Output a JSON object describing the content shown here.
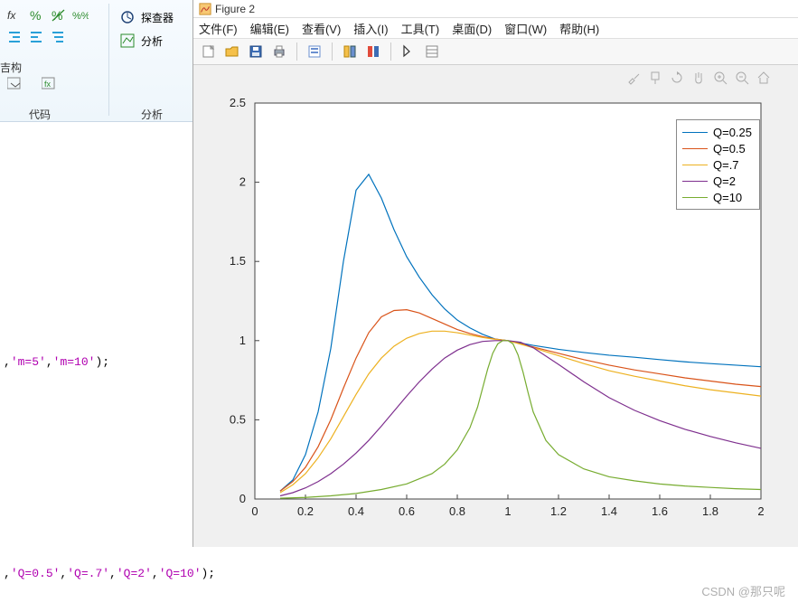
{
  "matlab_ribbon": {
    "group1_label": "代码",
    "group2_label": "分析",
    "btn_explorer": "探查器",
    "btn_analyze": "分析",
    "struct_label": "吉构"
  },
  "code": {
    "line1_prefix": ",",
    "line1_s1": "'m=5'",
    "line1_mid": ",",
    "line1_s2": "'m=10'",
    "line1_suffix": ");",
    "line2_prefix": ",",
    "line2_s1": "'Q=0.5'",
    "line2_m1": ",",
    "line2_s2": "'Q=.7'",
    "line2_m2": ",",
    "line2_s3": "'Q=2'",
    "line2_m3": ",",
    "line2_s4": "'Q=10'",
    "line2_suffix": ");"
  },
  "figwin": {
    "title": "Figure 2",
    "menus": [
      "文件(F)",
      "编辑(E)",
      "查看(V)",
      "插入(I)",
      "工具(T)",
      "桌面(D)",
      "窗口(W)",
      "帮助(H)"
    ]
  },
  "chart_data": {
    "type": "line",
    "xlim": [
      0,
      2
    ],
    "ylim": [
      0,
      2.5
    ],
    "xticks": [
      0,
      0.2,
      0.4,
      0.6,
      0.8,
      1,
      1.2,
      1.4,
      1.6,
      1.8,
      2
    ],
    "yticks": [
      0,
      0.5,
      1,
      1.5,
      2,
      2.5
    ],
    "xlabel": "",
    "ylabel": "",
    "title": "",
    "colors": {
      "Q=0.25": "#0072BD",
      "Q=0.5": "#D95319",
      "Q=.7": "#EDB120",
      "Q=2": "#7E2F8E",
      "Q=10": "#77AC30"
    },
    "legend": [
      "Q=0.25",
      "Q=0.5",
      "Q=.7",
      "Q=2",
      "Q=10"
    ],
    "series": [
      {
        "name": "Q=0.25",
        "x": [
          0.1,
          0.15,
          0.2,
          0.25,
          0.3,
          0.35,
          0.4,
          0.45,
          0.5,
          0.55,
          0.6,
          0.65,
          0.7,
          0.75,
          0.8,
          0.85,
          0.9,
          0.95,
          1.0,
          1.1,
          1.2,
          1.3,
          1.4,
          1.5,
          1.6,
          1.7,
          1.8,
          1.9,
          2.0
        ],
        "y": [
          0.05,
          0.12,
          0.28,
          0.55,
          0.95,
          1.5,
          1.95,
          2.05,
          1.9,
          1.7,
          1.53,
          1.4,
          1.29,
          1.2,
          1.13,
          1.08,
          1.04,
          1.01,
          1.0,
          0.97,
          0.945,
          0.925,
          0.908,
          0.895,
          0.88,
          0.866,
          0.855,
          0.845,
          0.835
        ]
      },
      {
        "name": "Q=0.5",
        "x": [
          0.1,
          0.15,
          0.2,
          0.25,
          0.3,
          0.35,
          0.4,
          0.45,
          0.5,
          0.55,
          0.6,
          0.65,
          0.7,
          0.75,
          0.8,
          0.85,
          0.9,
          0.95,
          1.0,
          1.1,
          1.2,
          1.3,
          1.4,
          1.5,
          1.6,
          1.7,
          1.8,
          1.9,
          2.0
        ],
        "y": [
          0.05,
          0.11,
          0.2,
          0.33,
          0.5,
          0.7,
          0.89,
          1.05,
          1.15,
          1.19,
          1.195,
          1.175,
          1.14,
          1.105,
          1.07,
          1.045,
          1.025,
          1.01,
          1.0,
          0.96,
          0.92,
          0.88,
          0.845,
          0.815,
          0.79,
          0.765,
          0.745,
          0.725,
          0.71
        ]
      },
      {
        "name": "Q=.7",
        "x": [
          0.1,
          0.15,
          0.2,
          0.25,
          0.3,
          0.35,
          0.4,
          0.45,
          0.5,
          0.55,
          0.6,
          0.65,
          0.7,
          0.75,
          0.8,
          0.85,
          0.9,
          0.95,
          1.0,
          1.1,
          1.2,
          1.3,
          1.4,
          1.5,
          1.6,
          1.7,
          1.8,
          1.9,
          2.0
        ],
        "y": [
          0.04,
          0.09,
          0.16,
          0.26,
          0.38,
          0.52,
          0.66,
          0.79,
          0.89,
          0.965,
          1.015,
          1.045,
          1.06,
          1.06,
          1.05,
          1.035,
          1.02,
          1.008,
          1.0,
          0.955,
          0.905,
          0.855,
          0.81,
          0.775,
          0.745,
          0.715,
          0.69,
          0.67,
          0.65
        ]
      },
      {
        "name": "Q=2",
        "x": [
          0.1,
          0.15,
          0.2,
          0.25,
          0.3,
          0.35,
          0.4,
          0.45,
          0.5,
          0.55,
          0.6,
          0.65,
          0.7,
          0.75,
          0.8,
          0.85,
          0.9,
          0.95,
          1.0,
          1.05,
          1.1,
          1.2,
          1.3,
          1.4,
          1.5,
          1.6,
          1.7,
          1.8,
          1.9,
          2.0
        ],
        "y": [
          0.02,
          0.04,
          0.07,
          0.11,
          0.16,
          0.22,
          0.29,
          0.37,
          0.46,
          0.555,
          0.65,
          0.74,
          0.82,
          0.89,
          0.94,
          0.975,
          0.995,
          1.0,
          1.0,
          0.99,
          0.955,
          0.85,
          0.74,
          0.64,
          0.56,
          0.495,
          0.44,
          0.395,
          0.355,
          0.32
        ]
      },
      {
        "name": "Q=10",
        "x": [
          0.1,
          0.2,
          0.3,
          0.4,
          0.5,
          0.6,
          0.7,
          0.75,
          0.8,
          0.85,
          0.88,
          0.9,
          0.92,
          0.94,
          0.96,
          0.98,
          1.0,
          1.02,
          1.04,
          1.06,
          1.08,
          1.1,
          1.15,
          1.2,
          1.3,
          1.4,
          1.5,
          1.6,
          1.7,
          1.8,
          1.9,
          2.0
        ],
        "y": [
          0.005,
          0.01,
          0.02,
          0.035,
          0.06,
          0.095,
          0.16,
          0.22,
          0.31,
          0.45,
          0.58,
          0.7,
          0.82,
          0.92,
          0.98,
          1.0,
          1.0,
          0.98,
          0.91,
          0.8,
          0.67,
          0.55,
          0.37,
          0.28,
          0.19,
          0.14,
          0.115,
          0.095,
          0.082,
          0.073,
          0.065,
          0.06
        ]
      }
    ]
  },
  "watermark": "CSDN @那只呢"
}
